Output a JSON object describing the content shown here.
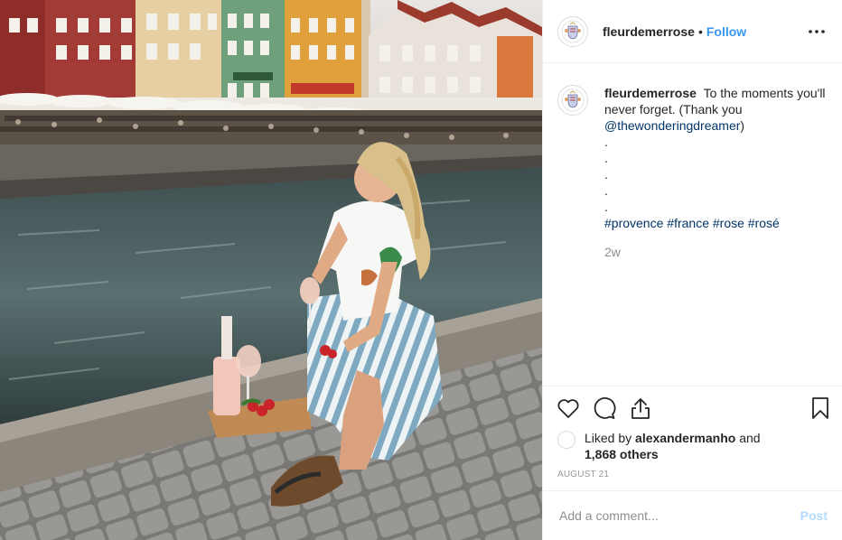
{
  "post": {
    "username": "fleurdemerrose",
    "separator": "•",
    "follow_label": "Follow",
    "more_icon": "more-horizontal-icon"
  },
  "caption": {
    "username": "fleurdemerrose",
    "text": "To the moments you'll never forget. (Thank you",
    "mention": "@thewonderingdreamer",
    "mention_suffix": ")",
    "dots": [
      ".",
      ".",
      ".",
      ".",
      "."
    ],
    "hashtags": [
      "#provence",
      "#france",
      "#rose",
      "#rosé"
    ],
    "age": "2w"
  },
  "actions": {
    "like_icon": "heart-icon",
    "comment_icon": "comment-icon",
    "share_icon": "share-icon",
    "save_icon": "bookmark-icon"
  },
  "likes": {
    "prefix": "Liked by",
    "user": "alexandermanho",
    "conjunction": "and",
    "others": "1,868 others"
  },
  "date": "AUGUST 21",
  "comment_box": {
    "placeholder": "Add a comment...",
    "post_label": "Post"
  },
  "colors": {
    "accent": "#3897f0",
    "post_disabled": "#b3dbff",
    "link": "#003569",
    "muted": "#8e8e8e"
  }
}
